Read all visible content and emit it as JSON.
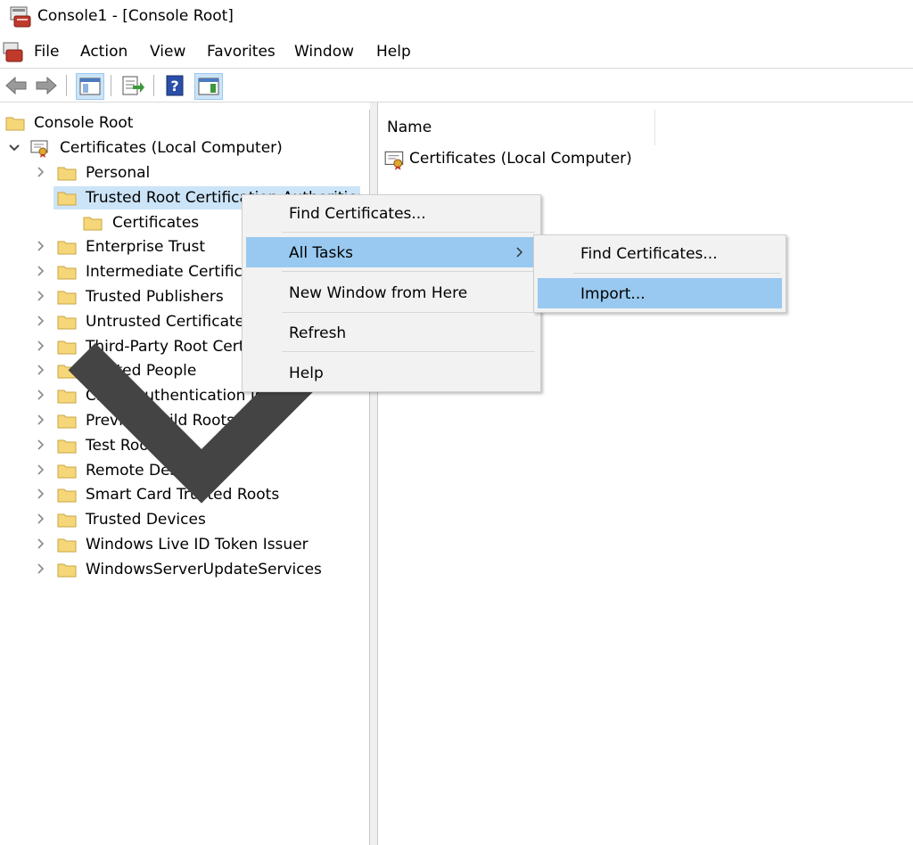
{
  "window": {
    "title": "Console1 - [Console Root]"
  },
  "menu": [
    "File",
    "Action",
    "View",
    "Favorites",
    "Window",
    "Help"
  ],
  "toolbar": {
    "icons": [
      "back-arrow-icon",
      "forward-arrow-icon",
      "show-hide-tree-icon",
      "export-list-icon",
      "help-icon",
      "show-hide-action-pane-icon"
    ]
  },
  "tree": {
    "root": "Console Root",
    "store": "Certificates (Local Computer)",
    "items": [
      "Personal",
      "Trusted Root Certification Authorities",
      "Certificates",
      "Enterprise Trust",
      "Intermediate Certification Authorities",
      "Trusted Publishers",
      "Untrusted Certificates",
      "Third-Party Root Certification Authorities",
      "Trusted People",
      "Client Authentication Issuers",
      "Preview Build Roots",
      "Test Roots",
      "Remote Desktop",
      "Smart Card Trusted Roots",
      "Trusted Devices",
      "Windows Live ID Token Issuer",
      "WindowsServerUpdateServices"
    ]
  },
  "list": {
    "column": "Name",
    "rows": [
      "Certificates (Local Computer)"
    ]
  },
  "context_menu": {
    "items": [
      "Find Certificates...",
      "All Tasks",
      "New Window from Here",
      "Refresh",
      "Help"
    ],
    "highlighted": "All Tasks"
  },
  "submenu": {
    "items": [
      "Find Certificates...",
      "Import..."
    ],
    "highlighted": "Import..."
  },
  "colors": {
    "selection": "#cce4f7",
    "menu_highlight": "#99c9f0",
    "folder": "#f5d77a"
  }
}
